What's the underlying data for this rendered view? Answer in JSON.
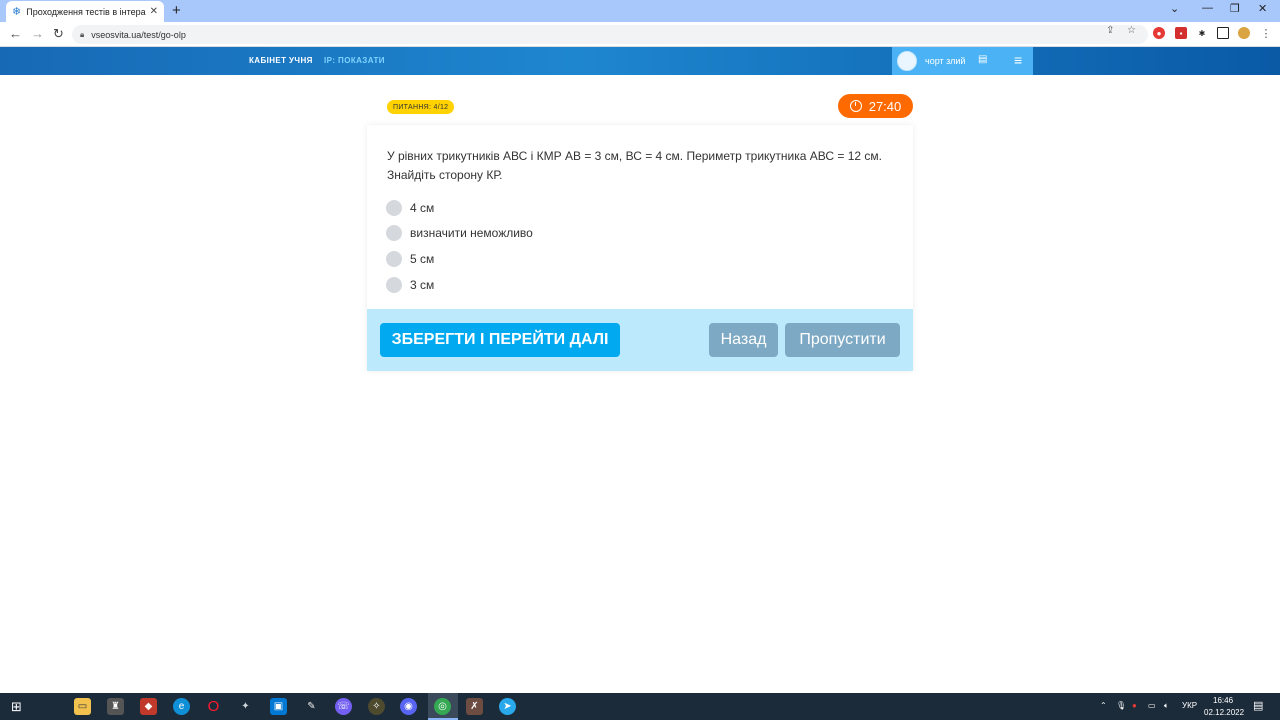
{
  "browser": {
    "tab_title": "Проходження тестів в інтеракт",
    "url": "vseosvita.ua/test/go-olp"
  },
  "header": {
    "cabinet_label": "КАБІНЕТ УЧНЯ",
    "ip_label": "IP: ПОКАЗАТИ",
    "username": "чорт злий"
  },
  "quiz": {
    "question_badge": "ПИТАННЯ: 4/12",
    "timer": "27:40",
    "question_text": "У рівних трикутників АВС і КМР АВ = 3 см, ВС = 4 см. Периметр трикутника АВС = 12 см. Знайдіть сторону КР.",
    "answers": [
      "4 см",
      "визначити неможливо",
      "5 см",
      "3 см"
    ],
    "save_button": "ЗБЕРЕГТИ І ПЕРЕЙТИ ДАЛІ",
    "back_button": "Назад",
    "skip_button": "Пропустити"
  },
  "taskbar": {
    "lang": "УКР",
    "time": "16:46",
    "date": "02.12.2022"
  },
  "colors": {
    "header_blue": "#1e86cf",
    "timer_orange": "#ff6a00",
    "badge_yellow": "#ffd200",
    "primary_button": "#00a9f0",
    "secondary_button": "#7ea9c4",
    "footer_bg": "#bde9fc"
  }
}
